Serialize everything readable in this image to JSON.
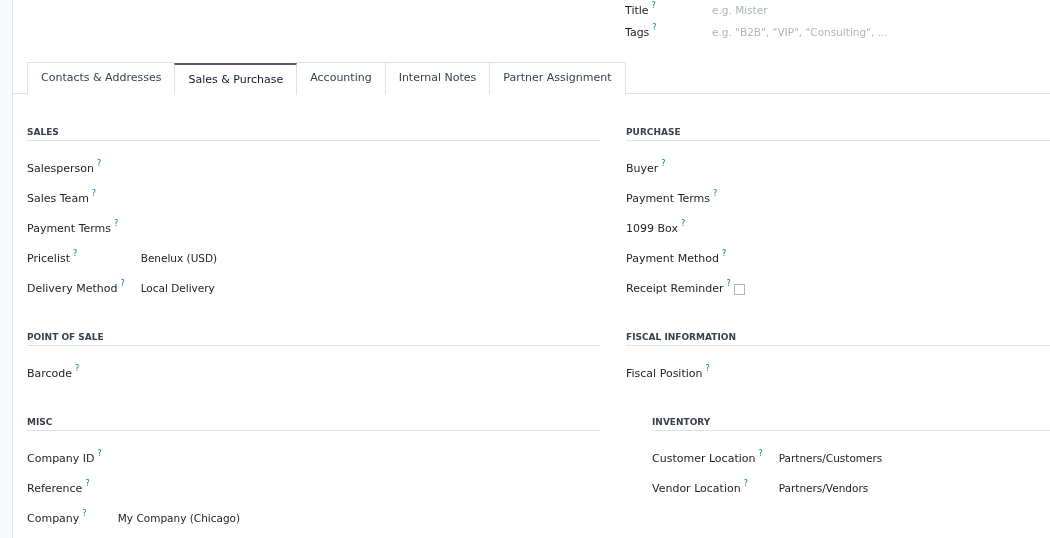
{
  "header_fields": [
    {
      "label": "Title",
      "help_mark": "?",
      "placeholder": "e.g. Mister"
    },
    {
      "label": "Tags",
      "help_mark": "?",
      "placeholder": "e.g. \"B2B\", \"VIP\", \"Consulting\", ..."
    }
  ],
  "tabs": [
    {
      "label": "Contacts & Addresses",
      "selected": false
    },
    {
      "label": "Sales & Purchase",
      "selected": true
    },
    {
      "label": "Accounting",
      "selected": false
    },
    {
      "label": "Internal Notes",
      "selected": false
    },
    {
      "label": "Partner Assignment",
      "selected": false
    }
  ],
  "left_sections": [
    {
      "title": "SALES",
      "fields": [
        {
          "label": "Salesperson",
          "help_mark": "?"
        },
        {
          "label": "Sales Team",
          "help_mark": "?"
        },
        {
          "label": "Payment Terms",
          "help_mark": "?"
        },
        {
          "label": "Pricelist",
          "help_mark": "?",
          "value": "Benelux (USD)"
        },
        {
          "label": "Delivery Method",
          "help_mark": "?",
          "value": "Local Delivery"
        }
      ]
    },
    {
      "title": "POINT OF SALE",
      "fields": [
        {
          "label": "Barcode",
          "help_mark": "?"
        }
      ]
    },
    {
      "title": "MISC",
      "fields": [
        {
          "label": "Company ID",
          "help_mark": "?"
        },
        {
          "label": "Reference",
          "help_mark": "?"
        },
        {
          "label": "Company",
          "help_mark": "?",
          "value": "My Company (Chicago)"
        }
      ]
    }
  ],
  "right_sections": [
    {
      "title": "PURCHASE",
      "indented": false,
      "fields": [
        {
          "label": "Buyer",
          "help_mark": "?"
        },
        {
          "label": "Payment Terms",
          "help_mark": "?"
        },
        {
          "label": "1099 Box",
          "help_mark": "?"
        },
        {
          "label": "Payment Method",
          "help_mark": "?"
        },
        {
          "label": "Receipt Reminder",
          "help_mark": "?",
          "kind": "checkbox",
          "checked": false
        }
      ]
    },
    {
      "title": "FISCAL INFORMATION",
      "indented": false,
      "fields": [
        {
          "label": "Fiscal Position",
          "help_mark": "?"
        }
      ]
    },
    {
      "title": "INVENTORY",
      "indented": true,
      "fields": [
        {
          "label": "Customer Location",
          "help_mark": "?",
          "value": "Partners/Customers"
        },
        {
          "label": "Vendor Location",
          "help_mark": "?",
          "value": "Partners/Vendors"
        }
      ]
    }
  ]
}
